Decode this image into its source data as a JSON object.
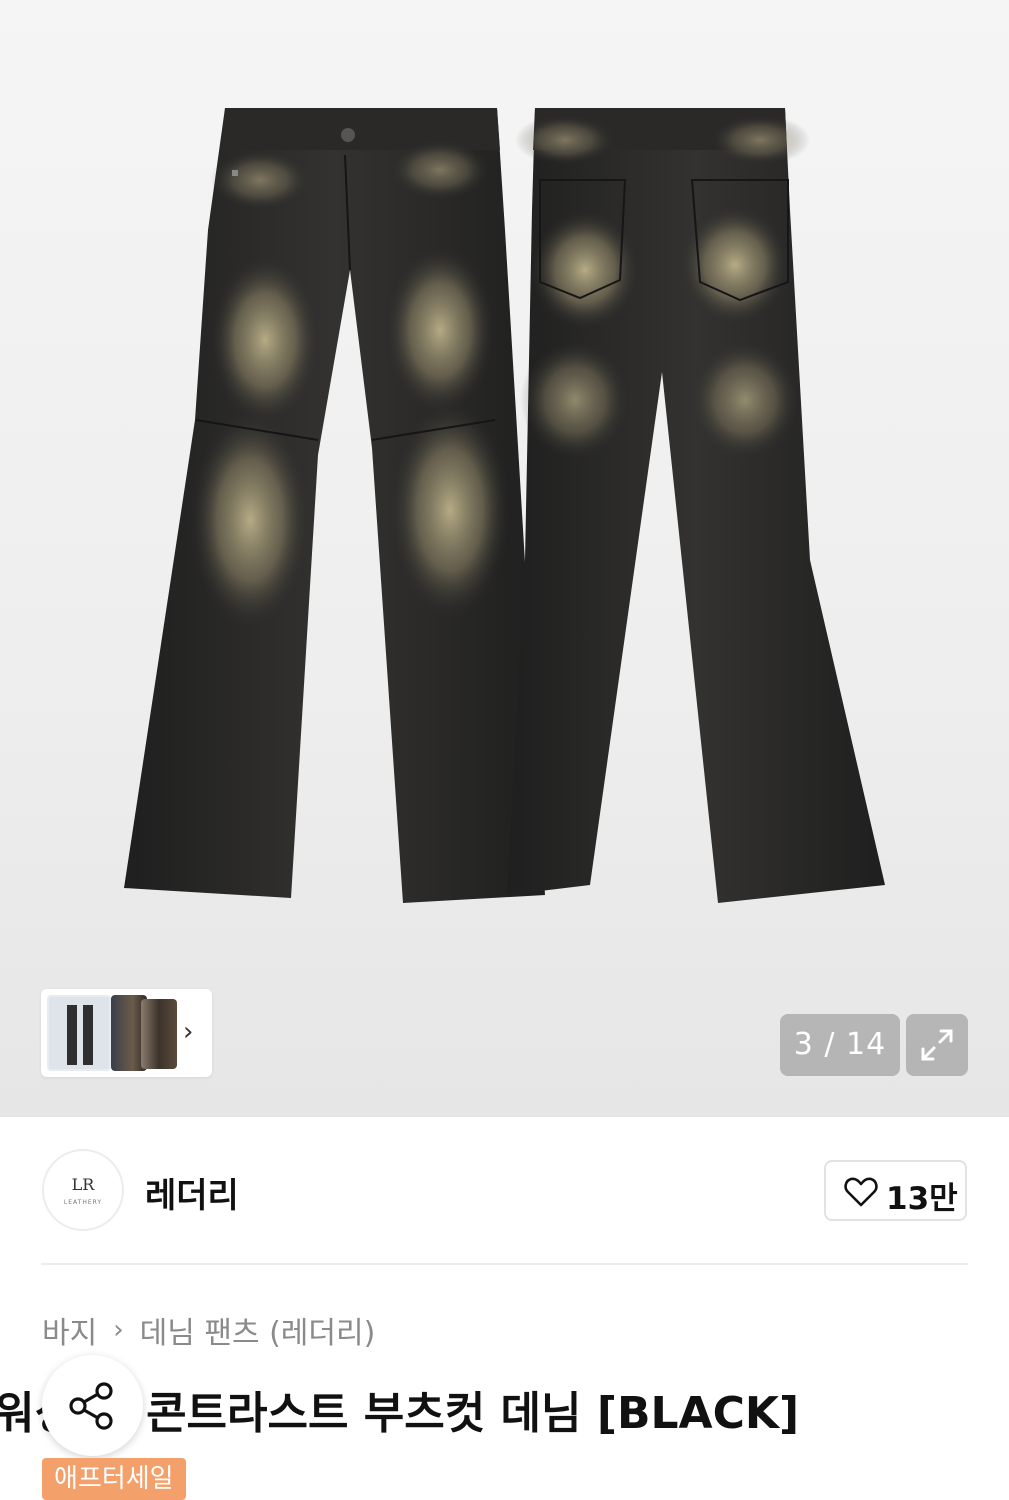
{
  "gallery": {
    "counter": "3 / 14",
    "thumb_next_icon": "chevron-right-icon",
    "expand_icon": "expand-icon"
  },
  "brand": {
    "name": "레더리",
    "logo_text": "LR",
    "logo_subtext": "LEATHERY",
    "like_icon": "heart-icon",
    "like_count": "13만"
  },
  "breadcrumb": {
    "items": [
      "바지",
      "데님 팬츠 (레더리)"
    ],
    "separator_icon": "chevron-right-icon"
  },
  "product": {
    "title": "워싱 지 콘트라스트 부츠컷 데님 [BLACK]",
    "title_visible": "지 콘트라스트 부츠컷 데님 [BLACK]",
    "badge": "애프터세일",
    "share_icon": "share-icon"
  },
  "colors": {
    "badge": "#f4a06b",
    "counter_bg": "#8c8c8c",
    "denim": "#2b2a29",
    "fade": "#b6aa86"
  }
}
